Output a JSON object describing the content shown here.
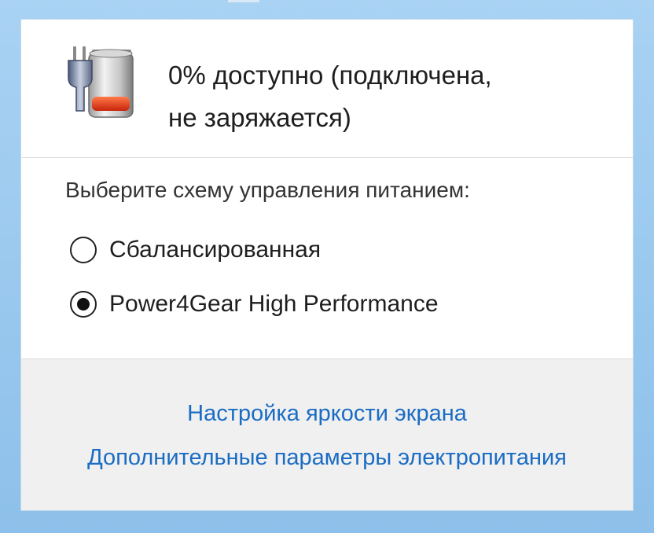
{
  "battery": {
    "status_line1": "0% доступно (подключена,",
    "status_line2": "не заряжается)",
    "icon": "battery-plugged-icon"
  },
  "scheme": {
    "prompt": "Выберите схему управления питанием:",
    "options": [
      {
        "label": "Сбалансированная",
        "selected": false
      },
      {
        "label": "Power4Gear High Performance",
        "selected": true
      }
    ]
  },
  "links": {
    "brightness": "Настройка яркости экрана",
    "power_options": "Дополнительные параметры электропитания"
  },
  "colors": {
    "link": "#1a6cc4",
    "frame": "#8fc1ea",
    "battery_level": "#e8421c"
  }
}
